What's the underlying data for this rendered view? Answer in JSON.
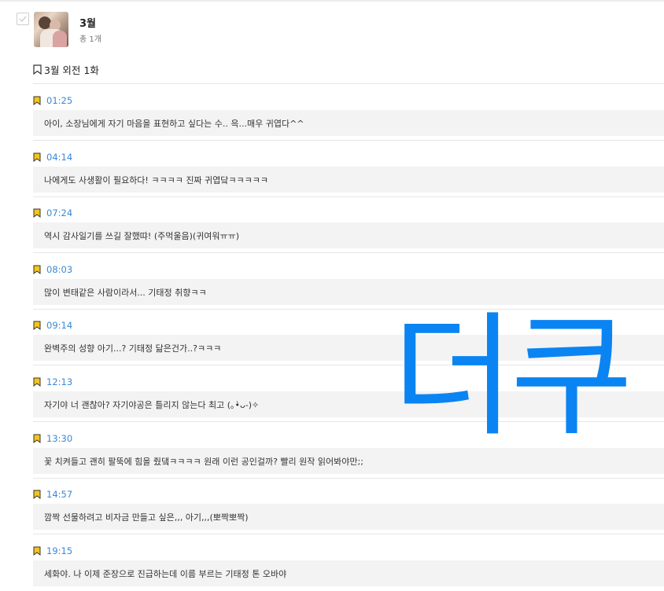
{
  "book": {
    "title": "3월",
    "count": "총 1개",
    "thumbnail": "book-cover-thumbnail"
  },
  "episode": {
    "title": "3월 외전 1화",
    "icon": "bookmark-outline-icon"
  },
  "entries": [
    {
      "time": "01:25",
      "text": "아이, 소장님에게 자기 마음을 표현하고 싶다는 수.. 윽...매우 귀엽다^^"
    },
    {
      "time": "04:14",
      "text": "나에게도 사생활이 필요하다! ㅋㅋㅋㅋ 진짜 귀엽닼ㅋㅋㅋㅋㅋ"
    },
    {
      "time": "07:24",
      "text": "역시 감사일기를 쓰길 잘했땨! (주먹울음)(귀여워ㅠㅠ)"
    },
    {
      "time": "08:03",
      "text": "많이 변태같은 사람이라서... 기태정 취향ㅋㅋ"
    },
    {
      "time": "09:14",
      "text": "완벽주의 성향 아기...? 기태정 닮은건가..?ㅋㅋㅋ"
    },
    {
      "time": "12:13",
      "text": "자기야 너 괜찮아? 자기야공은 틀리지 않는다 최고 (｡•̀ᴗ-)✧"
    },
    {
      "time": "13:30",
      "text": "꽃 치켜들고 괜히 팔뚝에 힘을 줬댘ㅋㅋㅋㅋ 원래 이런 공인걸까? 빨리 원작 읽어봐야만;;"
    },
    {
      "time": "14:57",
      "text": "깜짝 선물하려고 비자금 만들고 싶은,,, 아기,,,(뽀짝뽀짝)"
    },
    {
      "time": "19:15",
      "text": "세화야. 나 이제 준장으로 진급하는데 이름 부르는 기태정 톤 오바야"
    }
  ],
  "overlay": {
    "text": "더쿠"
  },
  "colors": {
    "accent_time": "#3a88d6",
    "bookmark_fill": "#f5c518",
    "overlay": "#0a84f2",
    "note_bg": "#f3f3f3"
  }
}
